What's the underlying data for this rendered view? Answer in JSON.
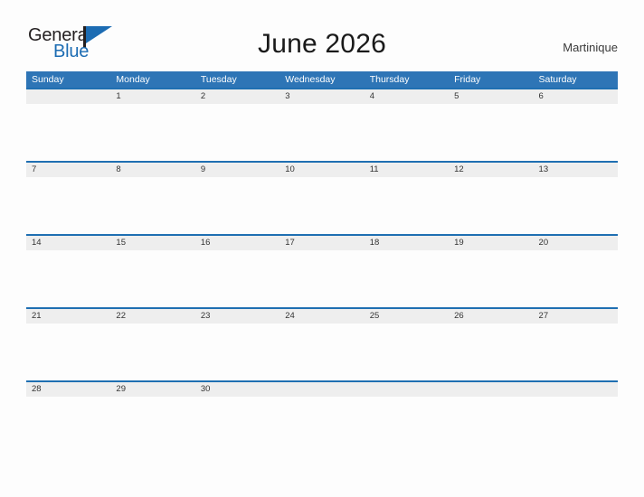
{
  "header": {
    "logo": {
      "word_one": "General",
      "word_two": "Blue",
      "icon": "flag-triangle-icon",
      "color_dark": "#231f20",
      "color_blue": "#1c6cb3"
    },
    "title": "June 2026",
    "location": "Martinique"
  },
  "calendar": {
    "month": "June",
    "year": "2026",
    "header_background": "#2e75b6",
    "header_text_color": "#ffffff",
    "day_band_background": "#eeeeee",
    "row_rule_color": "#1f6fb2",
    "weekdays": [
      "Sunday",
      "Monday",
      "Tuesday",
      "Wednesday",
      "Thursday",
      "Friday",
      "Saturday"
    ],
    "weeks": [
      {
        "days": [
          {
            "num": ""
          },
          {
            "num": "1"
          },
          {
            "num": "2"
          },
          {
            "num": "3"
          },
          {
            "num": "4"
          },
          {
            "num": "5"
          },
          {
            "num": "6"
          }
        ]
      },
      {
        "days": [
          {
            "num": "7"
          },
          {
            "num": "8"
          },
          {
            "num": "9"
          },
          {
            "num": "10"
          },
          {
            "num": "11"
          },
          {
            "num": "12"
          },
          {
            "num": "13"
          }
        ]
      },
      {
        "days": [
          {
            "num": "14"
          },
          {
            "num": "15"
          },
          {
            "num": "16"
          },
          {
            "num": "17"
          },
          {
            "num": "18"
          },
          {
            "num": "19"
          },
          {
            "num": "20"
          }
        ]
      },
      {
        "days": [
          {
            "num": "21"
          },
          {
            "num": "22"
          },
          {
            "num": "23"
          },
          {
            "num": "24"
          },
          {
            "num": "25"
          },
          {
            "num": "26"
          },
          {
            "num": "27"
          }
        ]
      },
      {
        "days": [
          {
            "num": "28"
          },
          {
            "num": "29"
          },
          {
            "num": "30"
          },
          {
            "num": ""
          },
          {
            "num": ""
          },
          {
            "num": ""
          },
          {
            "num": ""
          }
        ]
      }
    ]
  }
}
